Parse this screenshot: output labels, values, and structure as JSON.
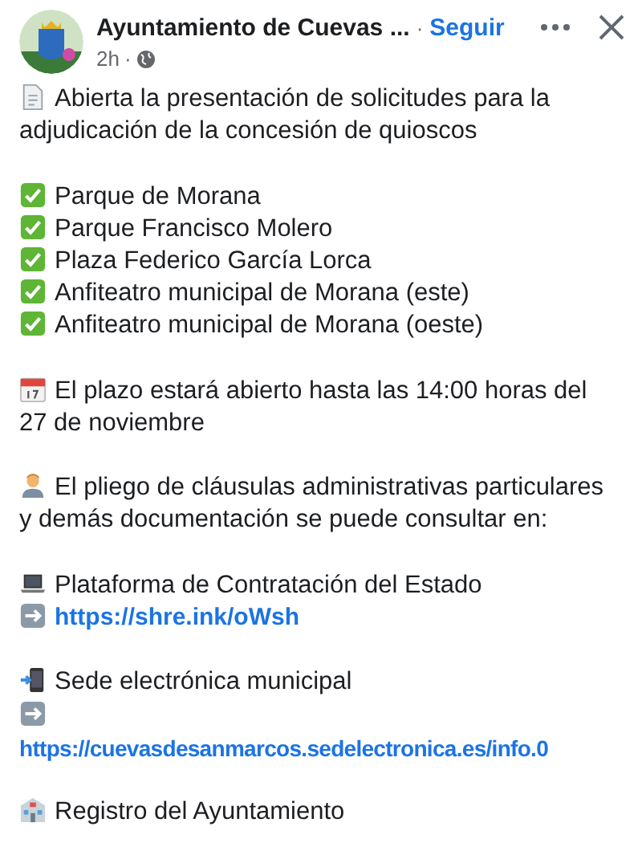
{
  "header": {
    "page_name": "Ayuntamiento de Cuevas ...",
    "separator": "·",
    "follow": "Seguir",
    "time": "2h",
    "time_separator": "·"
  },
  "paragraphs": [
    {
      "lines": [
        {
          "kind": "document",
          "text": "Abierta la presentación de solicitudes para la"
        },
        {
          "kind": "none",
          "text": "adjudicación de la concesión de quioscos"
        }
      ]
    },
    {
      "lines": [
        {
          "kind": "check",
          "text": "Parque de Morana"
        },
        {
          "kind": "check",
          "text": "Parque Francisco Molero"
        },
        {
          "kind": "check",
          "text": "Plaza Federico García Lorca"
        },
        {
          "kind": "check",
          "text": "Anfiteatro municipal de Morana (este)"
        },
        {
          "kind": "check",
          "text": "Anfiteatro municipal de Morana (oeste)"
        }
      ]
    },
    {
      "lines": [
        {
          "kind": "calendar",
          "text": "El plazo estará abierto hasta las 14:00 horas del"
        },
        {
          "kind": "none",
          "text": "27 de noviembre"
        }
      ]
    },
    {
      "lines": [
        {
          "kind": "person",
          "text": "El pliego de cláusulas administrativas particulares"
        },
        {
          "kind": "none",
          "text": "y demás documentación se puede consultar en:"
        }
      ]
    },
    {
      "lines": [
        {
          "kind": "laptop",
          "text": "Plataforma de Contratación del Estado"
        },
        {
          "kind": "arrow",
          "link": "https://shre.ink/oWsh"
        }
      ]
    },
    {
      "lines": [
        {
          "kind": "phone",
          "text": "Sede electrónica municipal"
        },
        {
          "kind": "arrow"
        },
        {
          "kind": "none",
          "link": "https://cuevasdesanmarcos.sedelectronica.es/info.0"
        }
      ]
    },
    {
      "lines": [
        {
          "kind": "building",
          "text": "Registro del Ayuntamiento"
        }
      ]
    }
  ]
}
